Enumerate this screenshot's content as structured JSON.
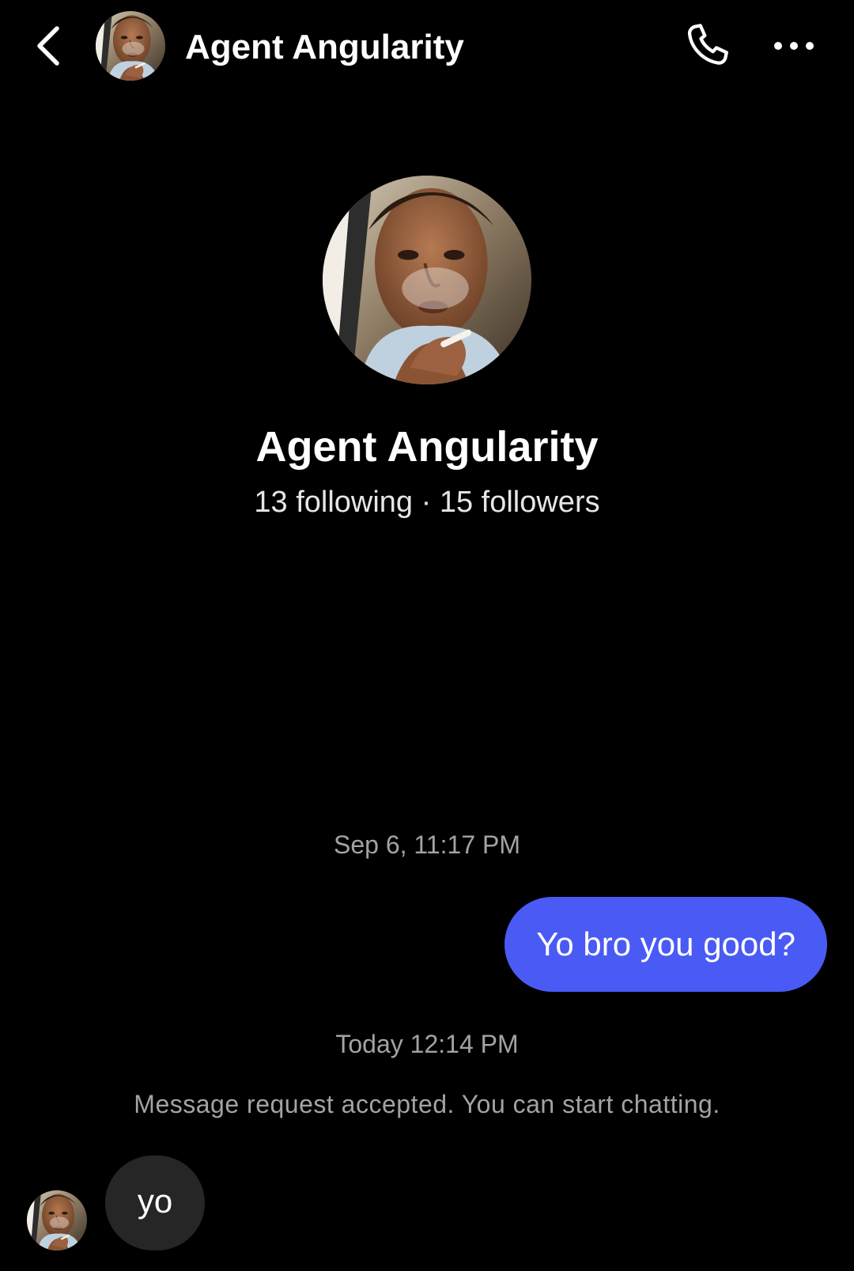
{
  "header": {
    "title": "Agent Angularity",
    "back_icon": "chevron-left-icon",
    "call_icon": "phone-icon",
    "more_icon": "more-horizontal-icon"
  },
  "profile": {
    "name": "Agent Angularity",
    "stats": "13 following · 15 followers"
  },
  "conversation": {
    "timestamps": [
      "Sep 6, 11:17 PM",
      "Today 12:14 PM"
    ],
    "outgoing_message": "Yo bro you good?",
    "system_note": "Message request accepted. You can start chatting.",
    "incoming_message": "yo"
  },
  "colors": {
    "background": "#000000",
    "outgoing_bubble": "#4a5af5",
    "incoming_bubble": "#262626",
    "muted_text": "#a3a3a3"
  }
}
